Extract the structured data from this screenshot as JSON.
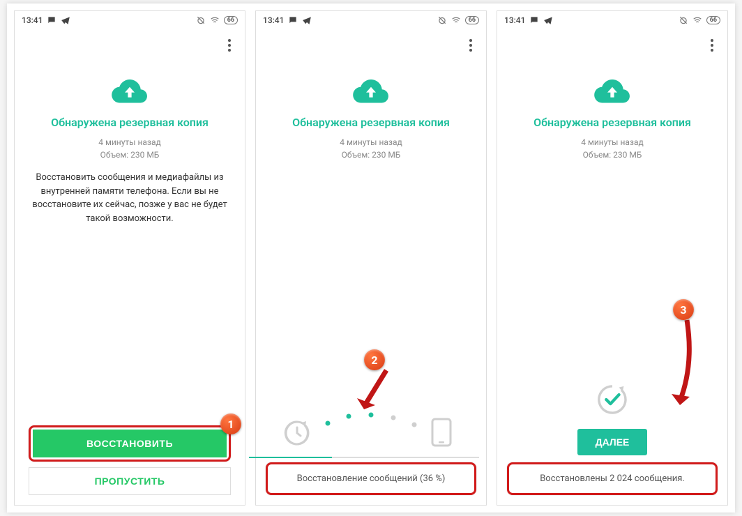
{
  "status": {
    "time": "13:41",
    "battery": "66"
  },
  "accent": "#1fbf9c",
  "primary_green": "#25c866",
  "header": {
    "title": "Обнаружена резервная копия",
    "meta_time": "4 минуты назад",
    "meta_size": "Объем: 230 МБ"
  },
  "screen1": {
    "description": "Восстановить сообщения и медиафайлы из внутренней памяти телефона. Если вы не восстановите их сейчас, позже у вас не будет такой возможности.",
    "restore_label": "ВОССТАНОВИТЬ",
    "skip_label": "ПРОПУСТИТЬ",
    "callout": "1"
  },
  "screen2": {
    "progress_percent": 36,
    "status_text": "Восстановление сообщений (36 %)",
    "callout": "2"
  },
  "screen3": {
    "next_label": "ДАЛЕЕ",
    "count": "2 024",
    "status_text": "Восстановлены 2 024 сообщения.",
    "callout": "3"
  }
}
